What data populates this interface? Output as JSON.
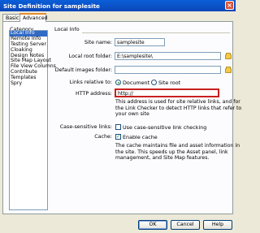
{
  "window": {
    "title": "Site Definition for samplesite",
    "close_glyph": "×"
  },
  "tabs": [
    {
      "label": "Basic",
      "active": false
    },
    {
      "label": "Advanced",
      "active": true
    }
  ],
  "category": {
    "label": "Category",
    "items": [
      "Local Info",
      "Remote Info",
      "Testing Server",
      "Cloaking",
      "Design Notes",
      "Site Map Layout",
      "File View Columns",
      "Contribute",
      "Templates",
      "Spry"
    ],
    "selected_index": 0
  },
  "section_title": "Local Info",
  "form": {
    "site_name_label": "Site name:",
    "site_name_value": "samplesite",
    "local_root_label": "Local root folder:",
    "local_root_value": "E:\\samplesite\\",
    "default_images_label": "Default images folder:",
    "default_images_value": "",
    "links_relative_label": "Links relative to:",
    "links_option_document": "Document",
    "links_option_site_root": "Site root",
    "links_selected": "Document",
    "http_label": "HTTP address:",
    "http_value": "http://",
    "http_note": [
      "This address is used for site relative links, and for",
      "the Link Checker to detect HTTP links that refer to",
      "your own site"
    ],
    "case_label": "Case-sensitive links:",
    "case_checkbox_label": "Use case-sensitive link checking",
    "case_checked": false,
    "cache_label": "Cache:",
    "cache_checkbox_label": "Enable cache",
    "cache_checked": true,
    "cache_note": [
      "The cache maintains file and asset information in",
      "the site.  This speeds up the Asset panel, link",
      "management, and Site Map features."
    ]
  },
  "buttons": {
    "ok": "OK",
    "cancel": "Cancel",
    "help": "Help"
  },
  "colors": {
    "title_bar": "#0B50C8",
    "selection": "#316AC5",
    "highlight_border": "#C8201F"
  }
}
